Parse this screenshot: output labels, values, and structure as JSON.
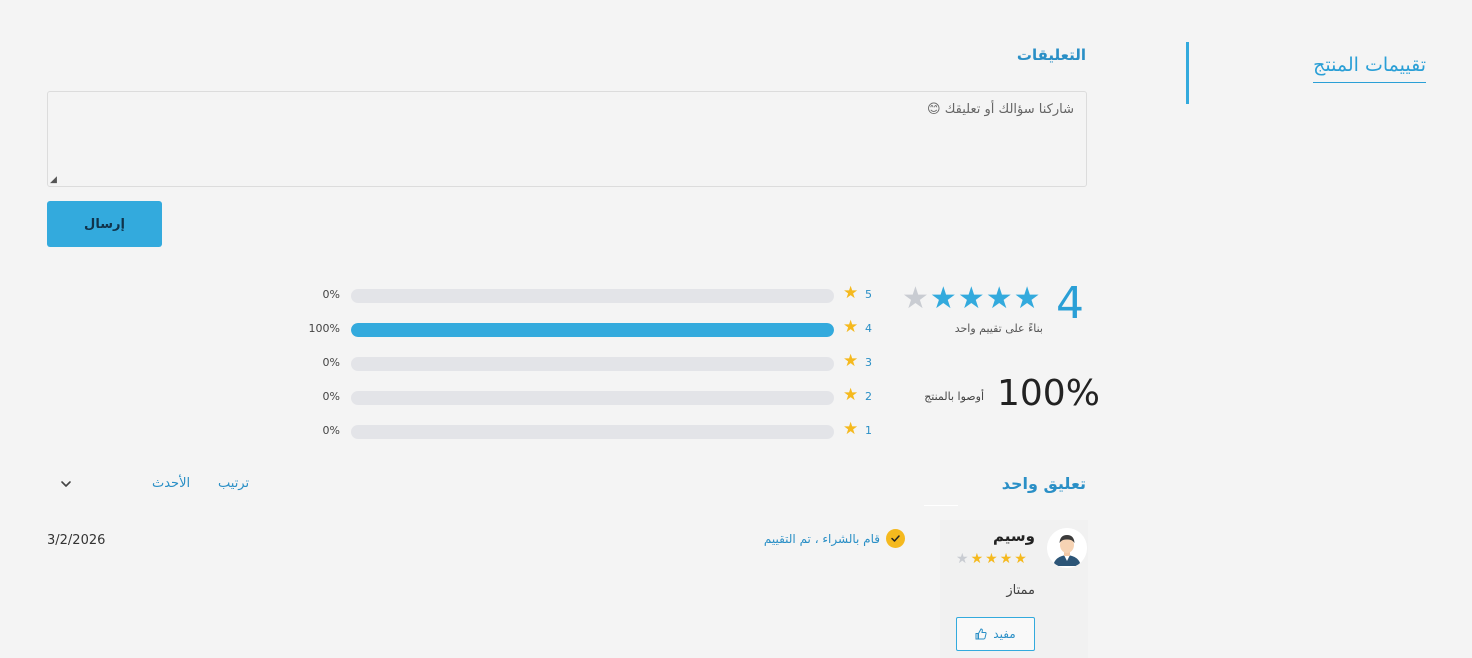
{
  "sidebar": {
    "tab_label": "تقييمات المنتج"
  },
  "comments": {
    "title": "التعليقات",
    "placeholder": "شاركنا سؤالك أو تعليقك 😊",
    "send_label": "إرسال"
  },
  "rating_summary": {
    "average": "4",
    "average_value": 4,
    "max_stars": 5,
    "based_on": "بناءً على تقييم واحد",
    "recommend_percent": "100%",
    "recommend_label": "أوصوا بالمنتج"
  },
  "distribution": [
    {
      "stars": "5",
      "percent_label": "0%",
      "fraction": 0
    },
    {
      "stars": "4",
      "percent_label": "100%",
      "fraction": 1
    },
    {
      "stars": "3",
      "percent_label": "0%",
      "fraction": 0
    },
    {
      "stars": "2",
      "percent_label": "0%",
      "fraction": 0
    },
    {
      "stars": "1",
      "percent_label": "0%",
      "fraction": 0
    }
  ],
  "reviews_header": {
    "count_label": "تعليق واحد",
    "sort_label": "ترتيب",
    "sort_value": "الأحدث"
  },
  "review": {
    "author": "وسيم",
    "rating": 4,
    "text": "ممتاز",
    "verified_label": "قام بالشراء ، تم التقييم",
    "date": "3/2/2026",
    "helpful_label": "مفيد"
  },
  "colors": {
    "accent": "#33aadd",
    "star_gold": "#f5b91e",
    "star_empty": "#c9ccd2"
  }
}
